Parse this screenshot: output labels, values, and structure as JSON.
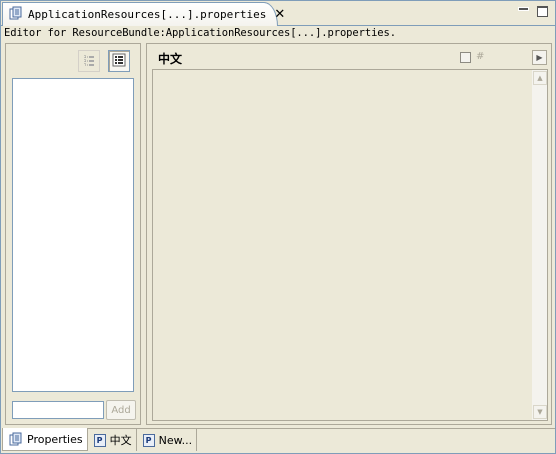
{
  "editor_tab": {
    "title": "ApplicationResources[...].properties",
    "icon": "properties-editor-icon",
    "close_icon": "close-icon"
  },
  "window_controls": [
    "minimize-icon",
    "maximize-icon"
  ],
  "caption": "Editor for ResourceBundle:ApplicationResources[...].properties.",
  "left_panel": {
    "flat_view_icon": "flat-list-icon",
    "tree_view_icon": "tree-list-icon",
    "add_input_value": "",
    "add_button_label": "Add"
  },
  "right_panel": {
    "locale_title": "中文",
    "hash_label": "#",
    "expand_icon": "arrow-right-icon",
    "value": ""
  },
  "bottom_tabs": [
    {
      "label": "Properties",
      "icon": "properties-icon",
      "active": true
    },
    {
      "label": "中文",
      "icon": "p-file-icon",
      "active": false
    },
    {
      "label": "New...",
      "icon": "p-file-icon",
      "active": false
    }
  ]
}
